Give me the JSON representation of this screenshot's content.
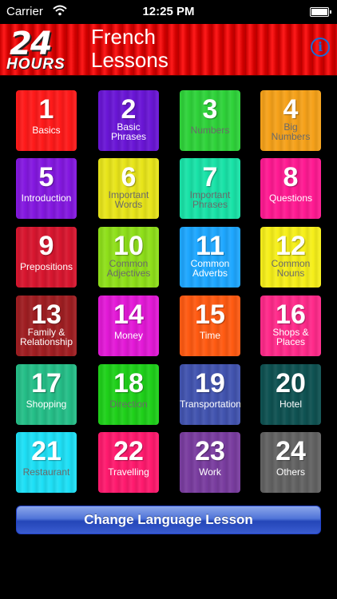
{
  "status_bar": {
    "carrier": "Carrier",
    "time": "12:25 PM"
  },
  "header": {
    "logo_number": "24",
    "logo_word": "HOURS",
    "title_line1": "French",
    "title_line2": "Lessons"
  },
  "info_button": "i",
  "lessons": [
    {
      "number": "1",
      "label_lines": [
        "Basics"
      ],
      "color": "#ff1a1a",
      "dark_label": false
    },
    {
      "number": "2",
      "label_lines": [
        "Basic",
        "Phrases"
      ],
      "color": "#6a16d6",
      "dark_label": false
    },
    {
      "number": "3",
      "label_lines": [
        "Numbers"
      ],
      "color": "#2fd33a",
      "dark_label": true
    },
    {
      "number": "4",
      "label_lines": [
        "Big",
        "Numbers"
      ],
      "color": "#f6a21a",
      "dark_label": true
    },
    {
      "number": "5",
      "label_lines": [
        "Introduction"
      ],
      "color": "#8418e0",
      "dark_label": false
    },
    {
      "number": "6",
      "label_lines": [
        "Important",
        "Words"
      ],
      "color": "#e8e51a",
      "dark_label": true
    },
    {
      "number": "7",
      "label_lines": [
        "Important",
        "Phrases"
      ],
      "color": "#19e3a8",
      "dark_label": true
    },
    {
      "number": "8",
      "label_lines": [
        "Questions"
      ],
      "color": "#ff1a92",
      "dark_label": false
    },
    {
      "number": "9",
      "label_lines": [
        "Prepositions"
      ],
      "color": "#d8162f",
      "dark_label": false
    },
    {
      "number": "10",
      "label_lines": [
        "Common",
        "Adjectives"
      ],
      "color": "#8fe01a",
      "dark_label": true
    },
    {
      "number": "11",
      "label_lines": [
        "Common",
        "Adverbs"
      ],
      "color": "#1ea7ff",
      "dark_label": false
    },
    {
      "number": "12",
      "label_lines": [
        "Common",
        "Nouns"
      ],
      "color": "#f6ef1a",
      "dark_label": true
    },
    {
      "number": "13",
      "label_lines": [
        "Family &",
        "Relationship"
      ],
      "color": "#a01e22",
      "dark_label": false
    },
    {
      "number": "14",
      "label_lines": [
        "Money"
      ],
      "color": "#e319d7",
      "dark_label": false
    },
    {
      "number": "15",
      "label_lines": [
        "Time"
      ],
      "color": "#ff5a12",
      "dark_label": false
    },
    {
      "number": "16",
      "label_lines": [
        "Shops &",
        "Places"
      ],
      "color": "#ff2a8a",
      "dark_label": false
    },
    {
      "number": "17",
      "label_lines": [
        "Shopping"
      ],
      "color": "#25bf88",
      "dark_label": false
    },
    {
      "number": "18",
      "label_lines": [
        "Direction"
      ],
      "color": "#1fd11a",
      "dark_label": true
    },
    {
      "number": "19",
      "label_lines": [
        "Transportation"
      ],
      "color": "#4254b0",
      "dark_label": false
    },
    {
      "number": "20",
      "label_lines": [
        "Hotel"
      ],
      "color": "#0f5252",
      "dark_label": false
    },
    {
      "number": "21",
      "label_lines": [
        "Restaurant"
      ],
      "color": "#1ee0f6",
      "dark_label": true
    },
    {
      "number": "22",
      "label_lines": [
        "Travelling"
      ],
      "color": "#ff1a6e",
      "dark_label": false
    },
    {
      "number": "23",
      "label_lines": [
        "Work"
      ],
      "color": "#7a3da0",
      "dark_label": false
    },
    {
      "number": "24",
      "label_lines": [
        "Others"
      ],
      "color": "#636363",
      "dark_label": false
    }
  ],
  "change_language_button": "Change Language Lesson"
}
